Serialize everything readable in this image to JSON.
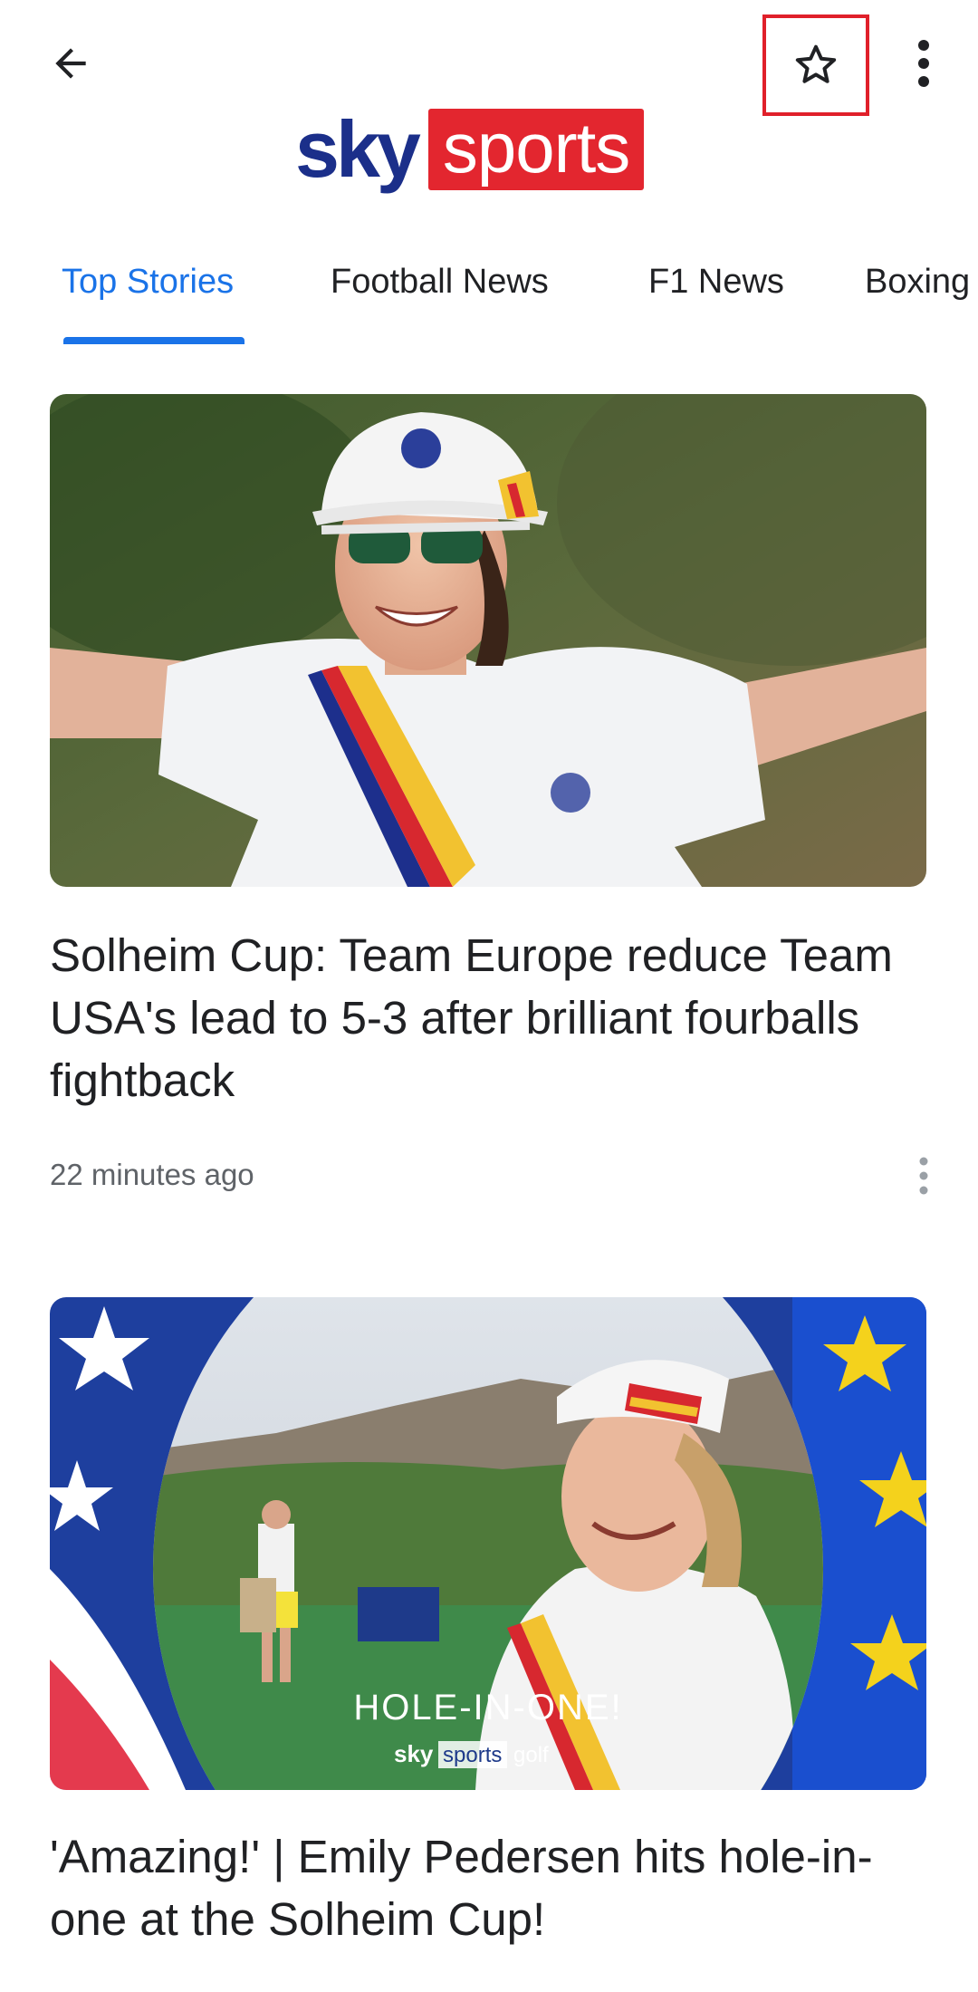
{
  "header": {
    "logo": {
      "sky": "sky",
      "sports": "sports"
    }
  },
  "tabs": [
    {
      "label": "Top Stories",
      "active": true
    },
    {
      "label": "Football News",
      "active": false
    },
    {
      "label": "F1 News",
      "active": false
    },
    {
      "label": "Boxing",
      "active": false
    }
  ],
  "articles": [
    {
      "headline": "Solheim Cup: Team Europe reduce Team USA's lead to 5-3 after brilliant fourballs fightback",
      "time": "22 minutes ago",
      "image": "golfer-celebrating-photo"
    },
    {
      "headline": "'Amazing!' | Emily Pedersen hits hole-in-one at the Solheim Cup!",
      "image": "hole-in-one-video-thumbnail",
      "overlay_text": "HOLE-IN-ONE!",
      "overlay_brand": {
        "sky": "sky",
        "sports": "sports",
        "golf": "golf"
      }
    }
  ],
  "colors": {
    "accent": "#1a73e8",
    "brand_red": "#e3262f",
    "brand_blue": "#1b2f8a",
    "highlight": "#e0202a"
  }
}
